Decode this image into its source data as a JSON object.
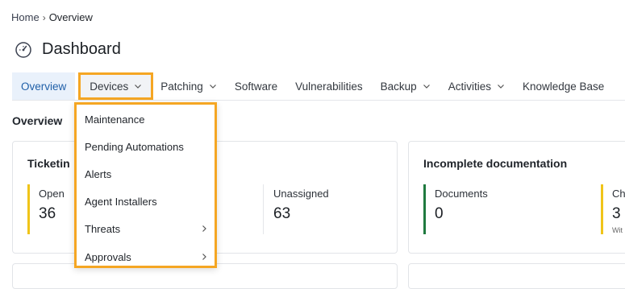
{
  "breadcrumb": {
    "home": "Home",
    "current": "Overview"
  },
  "page": {
    "title": "Dashboard",
    "icon": "gauge-icon"
  },
  "tabs": [
    {
      "label": "Overview"
    },
    {
      "label": "Devices"
    },
    {
      "label": "Patching"
    },
    {
      "label": "Software"
    },
    {
      "label": "Vulnerabilities"
    },
    {
      "label": "Backup"
    },
    {
      "label": "Activities"
    },
    {
      "label": "Knowledge Base"
    }
  ],
  "section": {
    "label": "Overview"
  },
  "ticketing": {
    "title": "Ticketin",
    "metrics": [
      {
        "label": "Open",
        "value": "36",
        "color": "#f0c419"
      },
      {
        "label": "Unassigned",
        "value": "63"
      }
    ]
  },
  "documentation": {
    "title": "Incomplete documentation",
    "metrics": [
      {
        "label": "Documents",
        "value": "0",
        "color": "#1f7a3f"
      },
      {
        "label": "Ch",
        "value": "3",
        "sub": "Wit",
        "color": "#f0c419"
      }
    ]
  },
  "devices_menu": {
    "items": [
      {
        "label": "Maintenance"
      },
      {
        "label": "Pending Automations"
      },
      {
        "label": "Alerts"
      },
      {
        "label": "Agent Installers"
      },
      {
        "label": "Threats"
      },
      {
        "label": "Approvals"
      }
    ]
  },
  "colors": {
    "highlight": "#f5a623",
    "active_tab_bg": "#e9f1fb",
    "active_tab_text": "#1f5fa8"
  }
}
